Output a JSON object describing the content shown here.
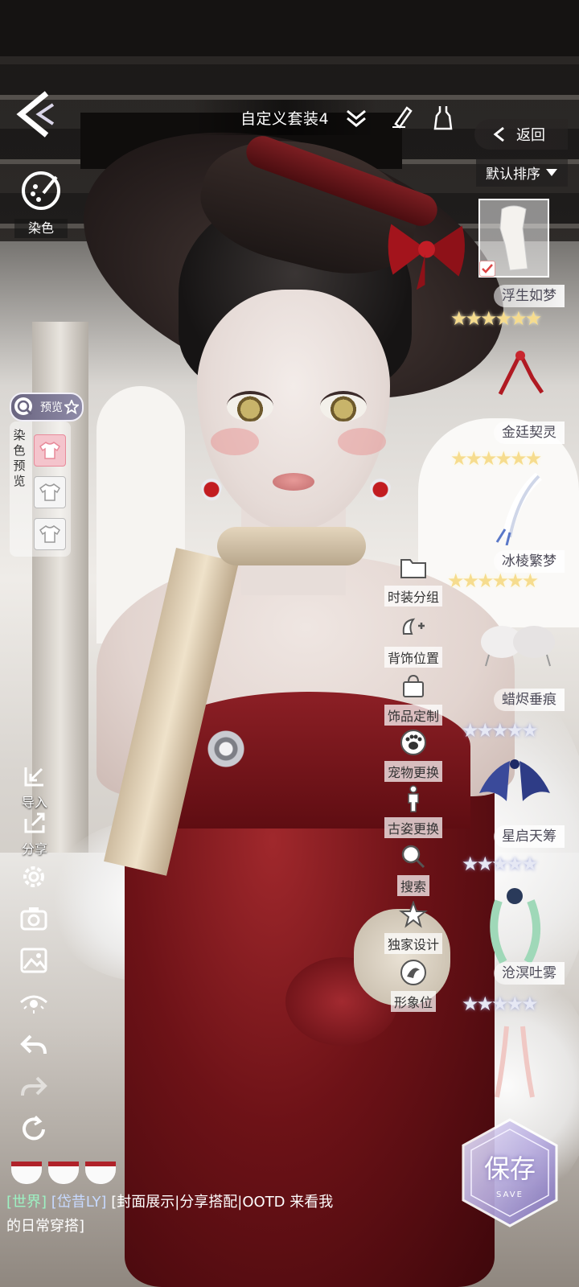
{
  "header": {
    "outfit_title": "自定义套装4",
    "return_label": "返回",
    "sort_label": "默认排序"
  },
  "left_panel": {
    "dye_label": "染色",
    "preview_toggle_label": "预览",
    "dye_preview_label": "染色预览",
    "tools": [
      {
        "label": "导入",
        "icon": "import-icon"
      },
      {
        "label": "分享",
        "icon": "share-icon"
      }
    ],
    "icons": [
      "settings-icon",
      "camera-icon",
      "image-icon",
      "eye-icon",
      "undo-icon",
      "redo-icon",
      "reset-icon"
    ]
  },
  "action_menu": [
    {
      "label": "时装分组",
      "icon": "folder-icon"
    },
    {
      "label": "背饰位置",
      "icon": "wing-position-icon"
    },
    {
      "label": "饰品定制",
      "icon": "bag-icon"
    },
    {
      "label": "宠物更换",
      "icon": "paw-icon"
    },
    {
      "label": "古姿更换",
      "icon": "pose-icon"
    },
    {
      "label": "搜索",
      "icon": "search-icon"
    },
    {
      "label": "独家设计",
      "icon": "star-icon"
    },
    {
      "label": "形象位",
      "icon": "profile-icon"
    }
  ],
  "items": [
    {
      "name": "浮生如梦",
      "stars": 6,
      "tier": "gold",
      "checked": true
    },
    {
      "name": "金廷契灵",
      "stars": 6,
      "tier": "gold"
    },
    {
      "name": "冰棱繁梦",
      "stars": 6,
      "tier": "gold"
    },
    {
      "name": "蜡烬垂痕",
      "stars": 5,
      "tier": "silver"
    },
    {
      "name": "星启天筹",
      "stars": 5,
      "tier": "silver"
    },
    {
      "name": "沧溟吐雾",
      "stars": 5,
      "tier": "silver"
    }
  ],
  "chat": {
    "channel": "[世界]",
    "user": "[岱昔LY]",
    "message": "[封面展示|分享搭配|OOTD 来看我的日常穿搭]"
  },
  "save": {
    "label": "保存",
    "sub": "SAVE"
  },
  "colors": {
    "gold_star": "#f6dc8e",
    "silver_star": "#e6e8f4",
    "dress_red": "#7a1419"
  }
}
